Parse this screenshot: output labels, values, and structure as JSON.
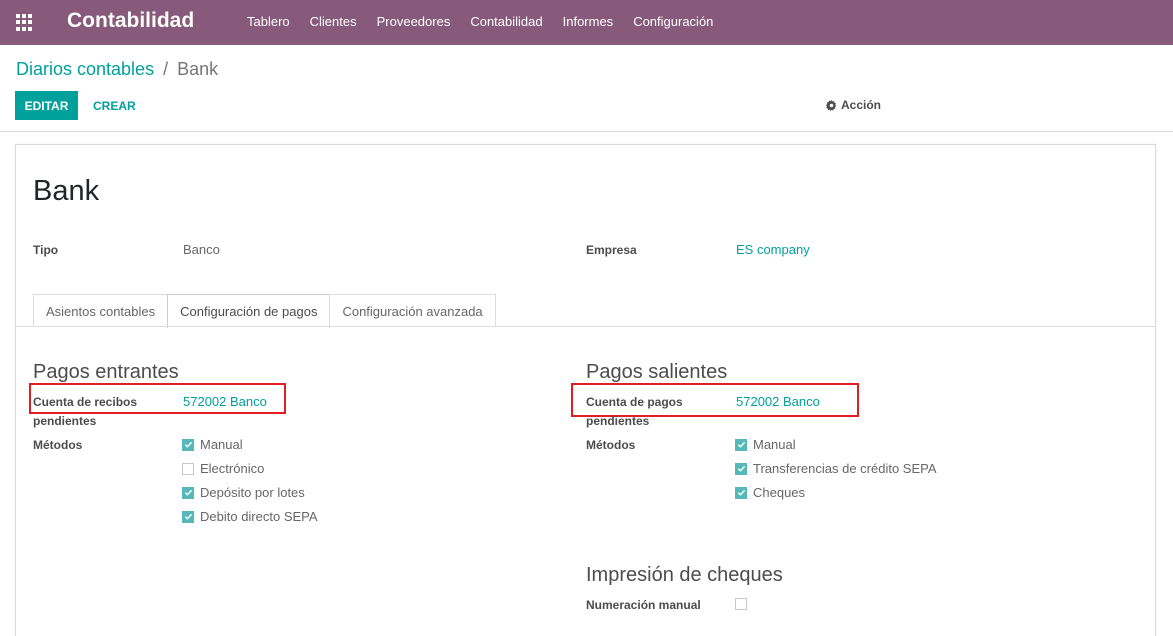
{
  "navbar": {
    "brand": "Contabilidad",
    "menu": [
      "Tablero",
      "Clientes",
      "Proveedores",
      "Contabilidad",
      "Informes",
      "Configuración"
    ]
  },
  "breadcrumb": {
    "parent": "Diarios contables",
    "separator": "/",
    "current": "Bank"
  },
  "toolbar": {
    "edit_label": "EDITAR",
    "create_label": "CREAR",
    "action_label": "Acción"
  },
  "record": {
    "title": "Bank",
    "tipo_label": "Tipo",
    "tipo_value": "Banco",
    "empresa_label": "Empresa",
    "empresa_value": "ES company"
  },
  "tabs": [
    {
      "label": "Asientos contables",
      "active": false
    },
    {
      "label": "Configuración de pagos",
      "active": true
    },
    {
      "label": "Configuración avanzada",
      "active": false
    }
  ],
  "incoming": {
    "title": "Pagos entrantes",
    "account_label_1": "Cuenta de recibos",
    "account_label_2": "pendientes",
    "account_value": "572002 Banco",
    "methods_label": "Métodos",
    "methods": [
      {
        "label": "Manual",
        "checked": true
      },
      {
        "label": "Electrónico",
        "checked": false
      },
      {
        "label": "Depósito por lotes",
        "checked": true
      },
      {
        "label": "Debito directo SEPA",
        "checked": true
      }
    ]
  },
  "outgoing": {
    "title": "Pagos salientes",
    "account_label_1": "Cuenta de pagos",
    "account_label_2": "pendientes",
    "account_value": "572002 Banco",
    "methods_label": "Métodos",
    "methods": [
      {
        "label": "Manual",
        "checked": true
      },
      {
        "label": "Transferencias de crédito SEPA",
        "checked": true
      },
      {
        "label": "Cheques",
        "checked": true
      }
    ]
  },
  "checks": {
    "title": "Impresión de cheques",
    "manual_label": "Numeración manual",
    "manual_checked": false
  },
  "colors": {
    "navbar": "#875a7b",
    "primary": "#00A09D",
    "highlight": "#e31d24",
    "checkbox": "#55b8ba"
  }
}
